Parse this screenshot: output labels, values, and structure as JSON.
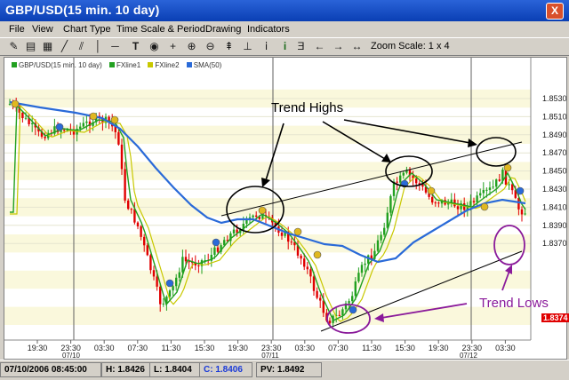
{
  "window": {
    "title": "GBP/USD(15 min.  10 day)",
    "close_label": "X"
  },
  "menu": [
    "File",
    "View",
    "Chart Type",
    "Time Scale & Period",
    "Drawing",
    "Indicators"
  ],
  "toolbar": {
    "icons": [
      "properties-icon",
      "print-icon",
      "draw-bar-icon",
      "add-line-icon",
      "add-channel-icon",
      "vertical-line-icon",
      "horizontal-line-icon",
      "text-tool-icon",
      "point-icon",
      "zoom-in-icon",
      "zoom-out-icon",
      "fib-icon",
      "anchor-icon",
      "indicator-icon",
      "info-icon",
      "chart-tool-icon",
      "back-arrow-icon",
      "forward-arrow-icon",
      "pan-arrow-icon"
    ],
    "zoom_label": "Zoom Scale: 1 x 4"
  },
  "legend": [
    {
      "label": "GBP/USD(15 min.  10 day)",
      "color": "#22a020"
    },
    {
      "label": "FXline1",
      "color": "#22a020"
    },
    {
      "label": "FXline2",
      "color": "#c8c800"
    },
    {
      "label": "SMA(50)",
      "color": "#2a6ad8"
    }
  ],
  "annotations": {
    "trend_highs": "Trend Highs",
    "trend_lows": "Trend Lows"
  },
  "price_axis": {
    "labels": [
      "1.8530",
      "1.8510",
      "1.8490",
      "1.8470",
      "1.8450",
      "1.8430",
      "1.8410",
      "1.8390",
      "1.8370"
    ],
    "last_price": "1.8374",
    "last_price_color": "#e00000"
  },
  "time_axis": {
    "labels": [
      "19:30",
      "23:30",
      "03:30",
      "07:30",
      "11:30",
      "15:30",
      "19:30",
      "23:30",
      "03:30",
      "07:30",
      "11:30",
      "15:30",
      "19:30",
      "23:30",
      "03:30"
    ],
    "dates": [
      "07/10",
      "07/11",
      "07/12"
    ]
  },
  "status": {
    "datetime": "07/10/2006 08:45:00",
    "high": "H: 1.8426",
    "low": "L: 1.8404",
    "close": "C: 1.8406",
    "pv": "PV: 1.8492"
  },
  "colors": {
    "sma": "#2a6ad8",
    "fxline1": "#22a020",
    "fxline2": "#c8c800",
    "up_candle": "#22a020",
    "down_candle": "#e00000",
    "circle": "#000000",
    "circle_purple": "#8a1a9a"
  }
}
